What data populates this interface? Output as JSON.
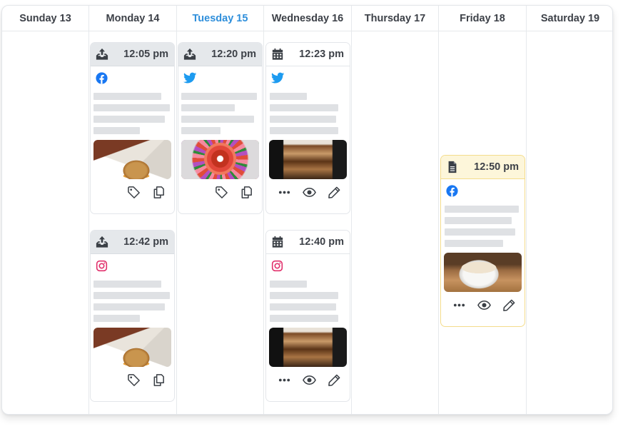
{
  "calendar": {
    "days": [
      {
        "label": "Sunday 13",
        "today": false
      },
      {
        "label": "Monday 14",
        "today": false
      },
      {
        "label": "Tuesday 15",
        "today": true
      },
      {
        "label": "Wednesday 16",
        "today": false
      },
      {
        "label": "Thursday 17",
        "today": false
      },
      {
        "label": "Friday 18",
        "today": false
      },
      {
        "label": "Saturday 19",
        "today": false
      }
    ],
    "today_color": "#2f8fdb"
  },
  "posts": {
    "mon_1": {
      "time": "12:05 pm",
      "status": "published",
      "status_icon": "upload-tray-icon",
      "network": "facebook",
      "image": "sandwich-photo",
      "actions": [
        "tag",
        "duplicate"
      ]
    },
    "mon_2": {
      "time": "12:42 pm",
      "status": "published",
      "status_icon": "upload-tray-icon",
      "network": "instagram",
      "image": "sandwich-photo",
      "actions": [
        "tag",
        "duplicate"
      ]
    },
    "tue_1": {
      "time": "12:20 pm",
      "status": "published",
      "status_icon": "upload-tray-icon",
      "network": "twitter",
      "image": "smoothie-photo",
      "actions": [
        "tag",
        "duplicate"
      ]
    },
    "wed_1": {
      "time": "12:23 pm",
      "status": "scheduled",
      "status_icon": "calendar-icon",
      "network": "twitter",
      "image": "iced-coffee-photo",
      "actions": [
        "more",
        "preview",
        "edit"
      ]
    },
    "wed_2": {
      "time": "12:40 pm",
      "status": "scheduled",
      "status_icon": "calendar-icon",
      "network": "instagram",
      "image": "iced-coffee-photo",
      "actions": [
        "more",
        "preview",
        "edit"
      ]
    },
    "fri_1": {
      "time": "12:50 pm",
      "status": "draft",
      "status_icon": "document-icon",
      "network": "facebook",
      "image": "latte-photo",
      "actions": [
        "more",
        "preview",
        "edit"
      ]
    }
  },
  "colors": {
    "facebook": "#1877f2",
    "twitter": "#1d9bf0",
    "instagram": "#e1306c",
    "draft_border": "#f4dc8c",
    "draft_header": "#fdf6da",
    "published_header": "#e5e8eb"
  }
}
